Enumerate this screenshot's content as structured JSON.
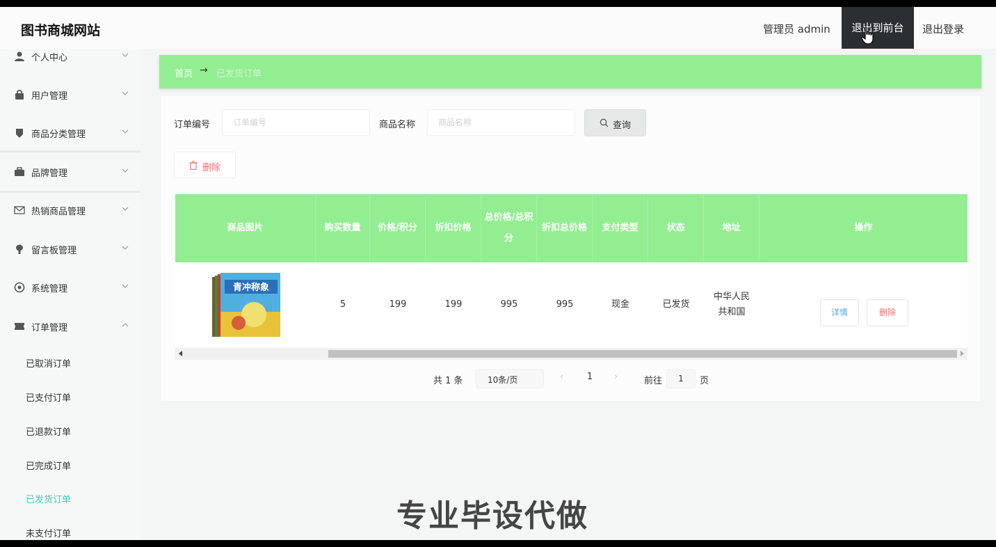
{
  "header": {
    "brand": "图书商城网站",
    "admin_label": "管理员 admin",
    "front_label": "退出到前台",
    "logout_label": "退出登录"
  },
  "sidebar": {
    "items": [
      {
        "label": "个人中心",
        "icon": "user-icon"
      },
      {
        "label": "用户管理",
        "icon": "lock-icon"
      },
      {
        "label": "商品分类管理",
        "icon": "tag-icon"
      },
      {
        "label": "品牌管理",
        "icon": "briefcase-icon"
      },
      {
        "label": "热销商品管理",
        "icon": "mail-icon"
      },
      {
        "label": "留言板管理",
        "icon": "pin-icon"
      },
      {
        "label": "系统管理",
        "icon": "settings-icon"
      },
      {
        "label": "订单管理",
        "icon": "ticket-icon"
      }
    ],
    "sub_items": [
      {
        "label": "已取消订单",
        "active": false
      },
      {
        "label": "已支付订单",
        "active": false
      },
      {
        "label": "已退款订单",
        "active": false
      },
      {
        "label": "已完成订单",
        "active": false
      },
      {
        "label": "已发货订单",
        "active": true
      },
      {
        "label": "未支付订单",
        "active": false
      }
    ]
  },
  "breadcrumb": {
    "home": "首页",
    "separator": "→",
    "current": "已发货订单"
  },
  "filters": {
    "order_no_label": "订单编号",
    "order_no_placeholder": "订单编号",
    "product_name_label": "商品名称",
    "product_name_placeholder": "商品名称",
    "query_label": "查询",
    "delete_label": "删除"
  },
  "table": {
    "headers": [
      "商品图片",
      "购买数量",
      "价格/积分",
      "折扣价格",
      "总价格/总积分",
      "折扣总价格",
      "支付类型",
      "状态",
      "地址",
      "操作"
    ],
    "rows": [
      {
        "image_alt": "书本封面",
        "cover_text": "青冲称象",
        "quantity": "5",
        "price": "199",
        "discount_price": "199",
        "total": "995",
        "discount_total": "995",
        "pay_type": "现金",
        "status": "已发货",
        "address_line1": "中华人民",
        "address_line2": "共和国",
        "detail_label": "详情",
        "delete_label": "删除"
      }
    ]
  },
  "pagination": {
    "total_text": "共 1 条",
    "page_size": "10条/页",
    "current_page": "1",
    "goto_label": "前往",
    "goto_value": "1",
    "page_unit": "页"
  },
  "watermark": "专业毕设代做",
  "colors": {
    "accent_green": "#92ee91",
    "active_teal": "#4fc7b5",
    "danger": "#f56c6c",
    "primary_blue": "#5aa9e6",
    "dark_button": "#2c2f32"
  }
}
